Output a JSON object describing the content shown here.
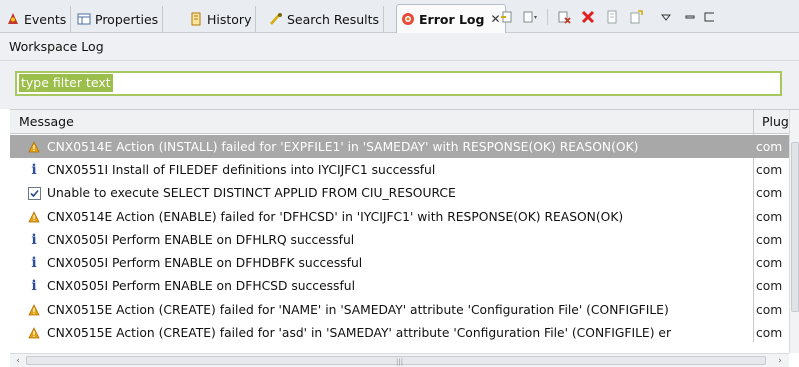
{
  "tabs": [
    {
      "label": "Events",
      "icon": "events-icon"
    },
    {
      "label": "Properties",
      "icon": "properties-icon"
    },
    {
      "label": "History",
      "icon": "history-icon"
    },
    {
      "label": "Search Results",
      "icon": "search-results-icon"
    },
    {
      "label": "Error Log",
      "icon": "error-log-icon",
      "active": true
    }
  ],
  "view": {
    "title": "Workspace Log"
  },
  "filter": {
    "value": "type filter text"
  },
  "table": {
    "columns": [
      "Message",
      "Plug"
    ],
    "rows": [
      {
        "icon": "warning-icon",
        "message": "CNX0514E Action (INSTALL) failed for 'EXPFILE1' in 'SAMEDAY' with RESPONSE(OK) REASON(OK)",
        "plugin": "com",
        "selected": true
      },
      {
        "icon": "info-icon",
        "message": "CNX0551I Install of FILEDEF definitions into IYCIJFC1 successful",
        "plugin": "com"
      },
      {
        "icon": "check-icon",
        "message": "Unable to execute SELECT DISTINCT APPLID FROM CIU_RESOURCE",
        "plugin": "com"
      },
      {
        "icon": "warning-icon",
        "message": "CNX0514E Action (ENABLE) failed for 'DFHCSD' in 'IYCIJFC1' with RESPONSE(OK) REASON(OK)",
        "plugin": "com"
      },
      {
        "icon": "info-icon",
        "message": "CNX0505I Perform ENABLE on DFHLRQ successful",
        "plugin": "com"
      },
      {
        "icon": "info-icon",
        "message": "CNX0505I Perform ENABLE on DFHDBFK successful",
        "plugin": "com"
      },
      {
        "icon": "info-icon",
        "message": "CNX0505I Perform ENABLE on DFHCSD successful",
        "plugin": "com"
      },
      {
        "icon": "warning-icon",
        "message": "CNX0515E Action (CREATE) failed for 'NAME' in 'SAMEDAY' attribute 'Configuration File' (CONFIGFILE)",
        "plugin": "com"
      },
      {
        "icon": "warning-icon",
        "message": "CNX0515E Action (CREATE) failed for 'asd' in 'SAMEDAY' attribute 'Configuration File' (CONFIGFILE) er",
        "plugin": "com"
      }
    ]
  },
  "colors": {
    "selected_row": "#a8a8a8",
    "filter_border": "#a7c75f",
    "filter_selection": "#9bbf4a",
    "warning": "#e8a010",
    "info": "#2a4f9c"
  }
}
